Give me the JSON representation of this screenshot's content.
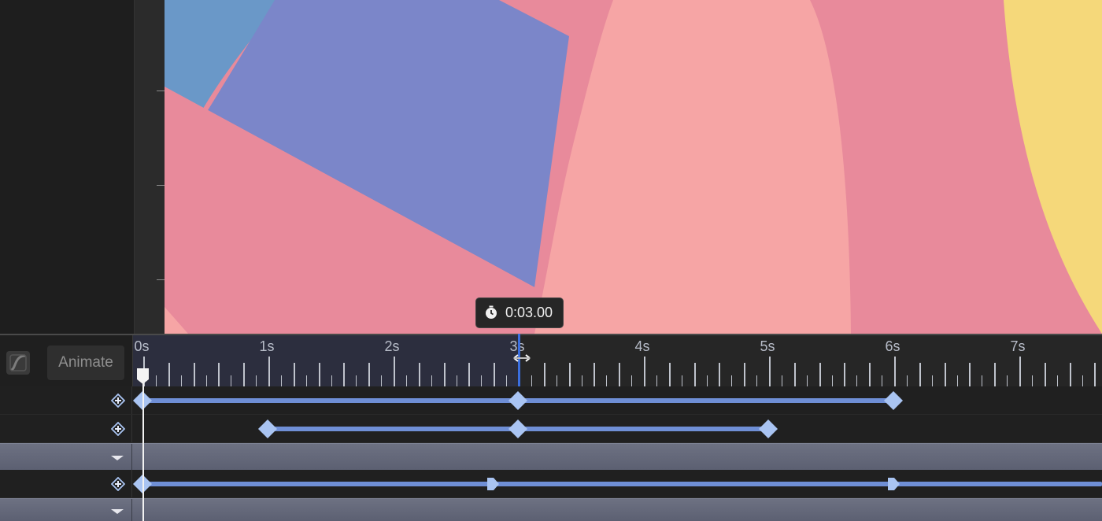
{
  "toolbar": {
    "easing_icon": "easing-curve-icon",
    "animate_label": "Animate"
  },
  "ruler": {
    "seconds": [
      "0s",
      "1s",
      "2s",
      "3s",
      "4s",
      "5s",
      "6s",
      "7s"
    ]
  },
  "playhead": {
    "time_label": "0:03.00",
    "icon": "stopwatch-icon"
  },
  "tracks": [
    {
      "type": "keyframes",
      "keyframes_s": [
        0,
        3,
        6
      ],
      "add_icon": "add-keyframe-icon"
    },
    {
      "type": "keyframes",
      "keyframes_s": [
        1,
        3,
        5
      ],
      "add_icon": "add-keyframe-icon"
    },
    {
      "type": "group",
      "icon": "collapse-icon"
    },
    {
      "type": "keyframes",
      "keyframes_s": [
        0,
        2.8,
        6
      ],
      "add_icon": "add-keyframe-icon"
    },
    {
      "type": "group",
      "icon": "collapse-icon"
    }
  ],
  "colors": {
    "accent_blue": "#3b6fe0",
    "keyframe": "#a9c4f2",
    "keyframe_bar": "#6f8fd6",
    "canvas_pink": "#e88a9b",
    "canvas_light_pink": "#f6a5a5",
    "canvas_blue": "#7b86c9",
    "canvas_sky": "#6a98c8",
    "canvas_yellow": "#f5d87a"
  }
}
